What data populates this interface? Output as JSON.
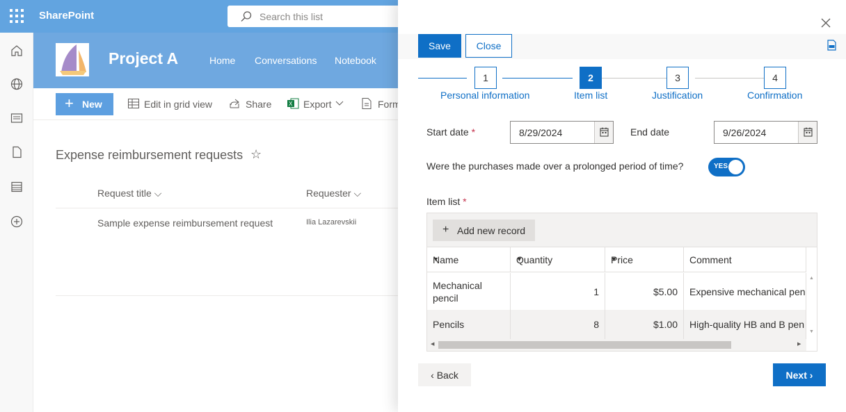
{
  "suite": {
    "app_name": "SharePoint",
    "search_placeholder": "Search this list"
  },
  "site": {
    "title": "Project A",
    "nav": [
      "Home",
      "Conversations",
      "Notebook"
    ]
  },
  "commands": {
    "new": "New",
    "edit_grid": "Edit in grid view",
    "share": "Share",
    "export": "Export",
    "form": "Form"
  },
  "list": {
    "title": "Expense reimbursement requests",
    "columns": [
      "Request title",
      "Requester"
    ],
    "rows": [
      {
        "title": "Sample expense reimbursement request",
        "requester": "Ilia Lazarevskii"
      }
    ]
  },
  "panel": {
    "save": "Save",
    "close": "Close",
    "steps": [
      {
        "num": "1",
        "label": "Personal information"
      },
      {
        "num": "2",
        "label": "Item list"
      },
      {
        "num": "3",
        "label": "Justification"
      },
      {
        "num": "4",
        "label": "Confirmation"
      }
    ],
    "active_step": 2,
    "start_date_label": "Start date",
    "start_date": "8/29/2024",
    "end_date_label": "End date",
    "end_date": "9/26/2024",
    "prolonged_question": "Were the purchases made over a prolonged period of time?",
    "toggle_text": "YES",
    "item_list_label": "Item list",
    "required_mark": "*",
    "add_record": "Add new record",
    "grid_columns": [
      "Name",
      "Quantity",
      "Price",
      "Comment"
    ],
    "grid_rows": [
      {
        "name": "Mechanical pencil",
        "quantity": "1",
        "price": "$5.00",
        "comment": "Expensive mechanical penc"
      },
      {
        "name": "Pencils",
        "quantity": "8",
        "price": "$1.00",
        "comment": "High-quality HB and B pen"
      }
    ],
    "back": "Back",
    "next": "Next"
  },
  "colors": {
    "suite_bar": "#62a4e0",
    "primary": "#0f6fc6",
    "required": "#c4314b"
  }
}
